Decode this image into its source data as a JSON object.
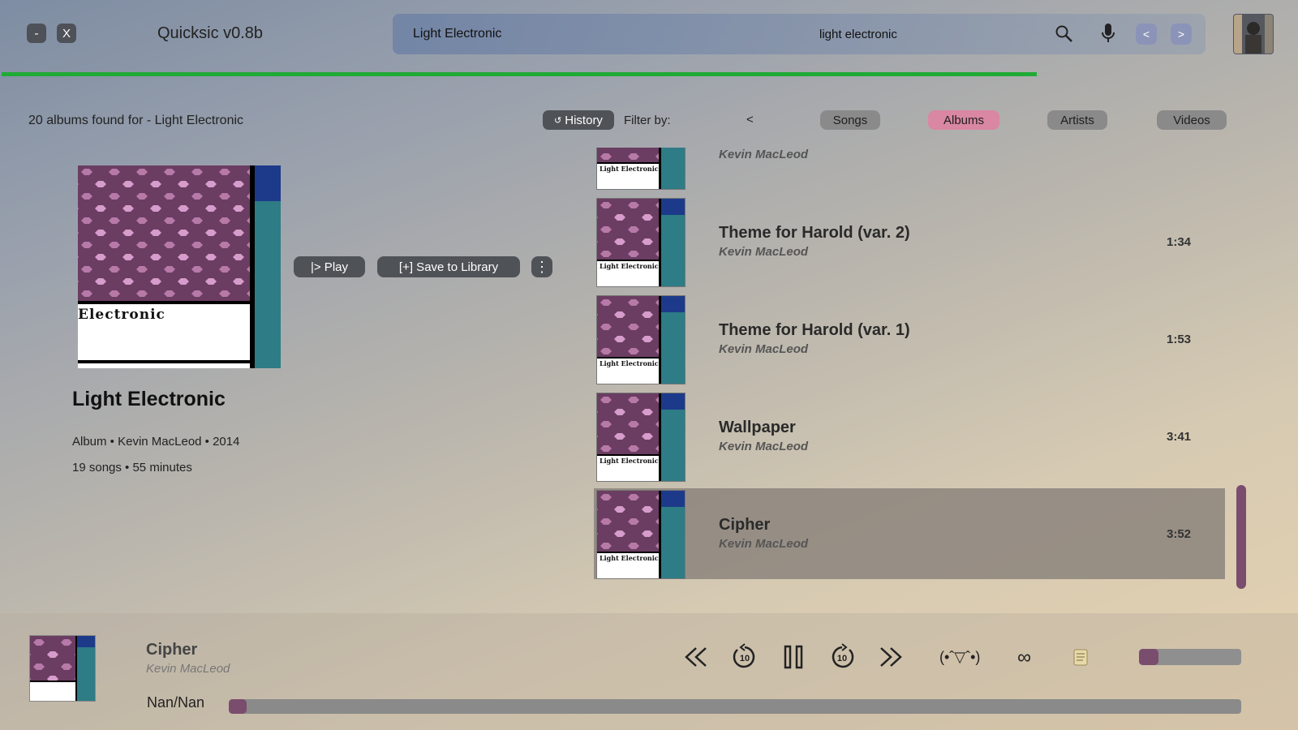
{
  "app": {
    "title": "Quicksic v0.8b",
    "minimize_label": "-",
    "close_label": "X"
  },
  "search": {
    "label": "Light Electronic",
    "value": "light electronic",
    "prev_label": "<",
    "next_label": ">"
  },
  "results": {
    "found_text": "20 albums found for - Light Electronic",
    "history_label": "History"
  },
  "filters": {
    "label": "Filter by:",
    "prev_label": "<",
    "items": [
      {
        "label": "Songs",
        "active": false
      },
      {
        "label": "Albums",
        "active": true
      },
      {
        "label": "Artists",
        "active": false
      },
      {
        "label": "Videos",
        "active": false
      }
    ]
  },
  "album": {
    "cover_text": "Electronic",
    "title": "Light Electronic",
    "meta": "Album • Kevin MacLeod • 2014",
    "count": "19 songs • 55 minutes",
    "play_label": "|> Play",
    "save_label": "[+] Save to Library",
    "more_label": "⋮"
  },
  "songs": [
    {
      "title": "",
      "artist": "Kevin MacLeod",
      "duration": ""
    },
    {
      "title": "Theme for Harold (var. 2)",
      "artist": "Kevin MacLeod",
      "duration": "1:34"
    },
    {
      "title": "Theme for Harold (var. 1)",
      "artist": "Kevin MacLeod",
      "duration": "1:53"
    },
    {
      "title": "Wallpaper",
      "artist": "Kevin MacLeod",
      "duration": "3:41"
    },
    {
      "title": "Cipher",
      "artist": "Kevin MacLeod",
      "duration": "3:52"
    }
  ],
  "thumb_caption": "Light Electronic",
  "player": {
    "title": "Cipher",
    "artist": "Kevin MacLeod",
    "time": "Nan/Nan",
    "emoticon": "(•ˆ▽ˆ•)",
    "loop_icon": "∞",
    "seek_progress": 0,
    "volume": 0.05
  },
  "colors": {
    "accent": "#7a4d6e",
    "progress": "#1faa35",
    "active_filter": "#d987a3"
  }
}
